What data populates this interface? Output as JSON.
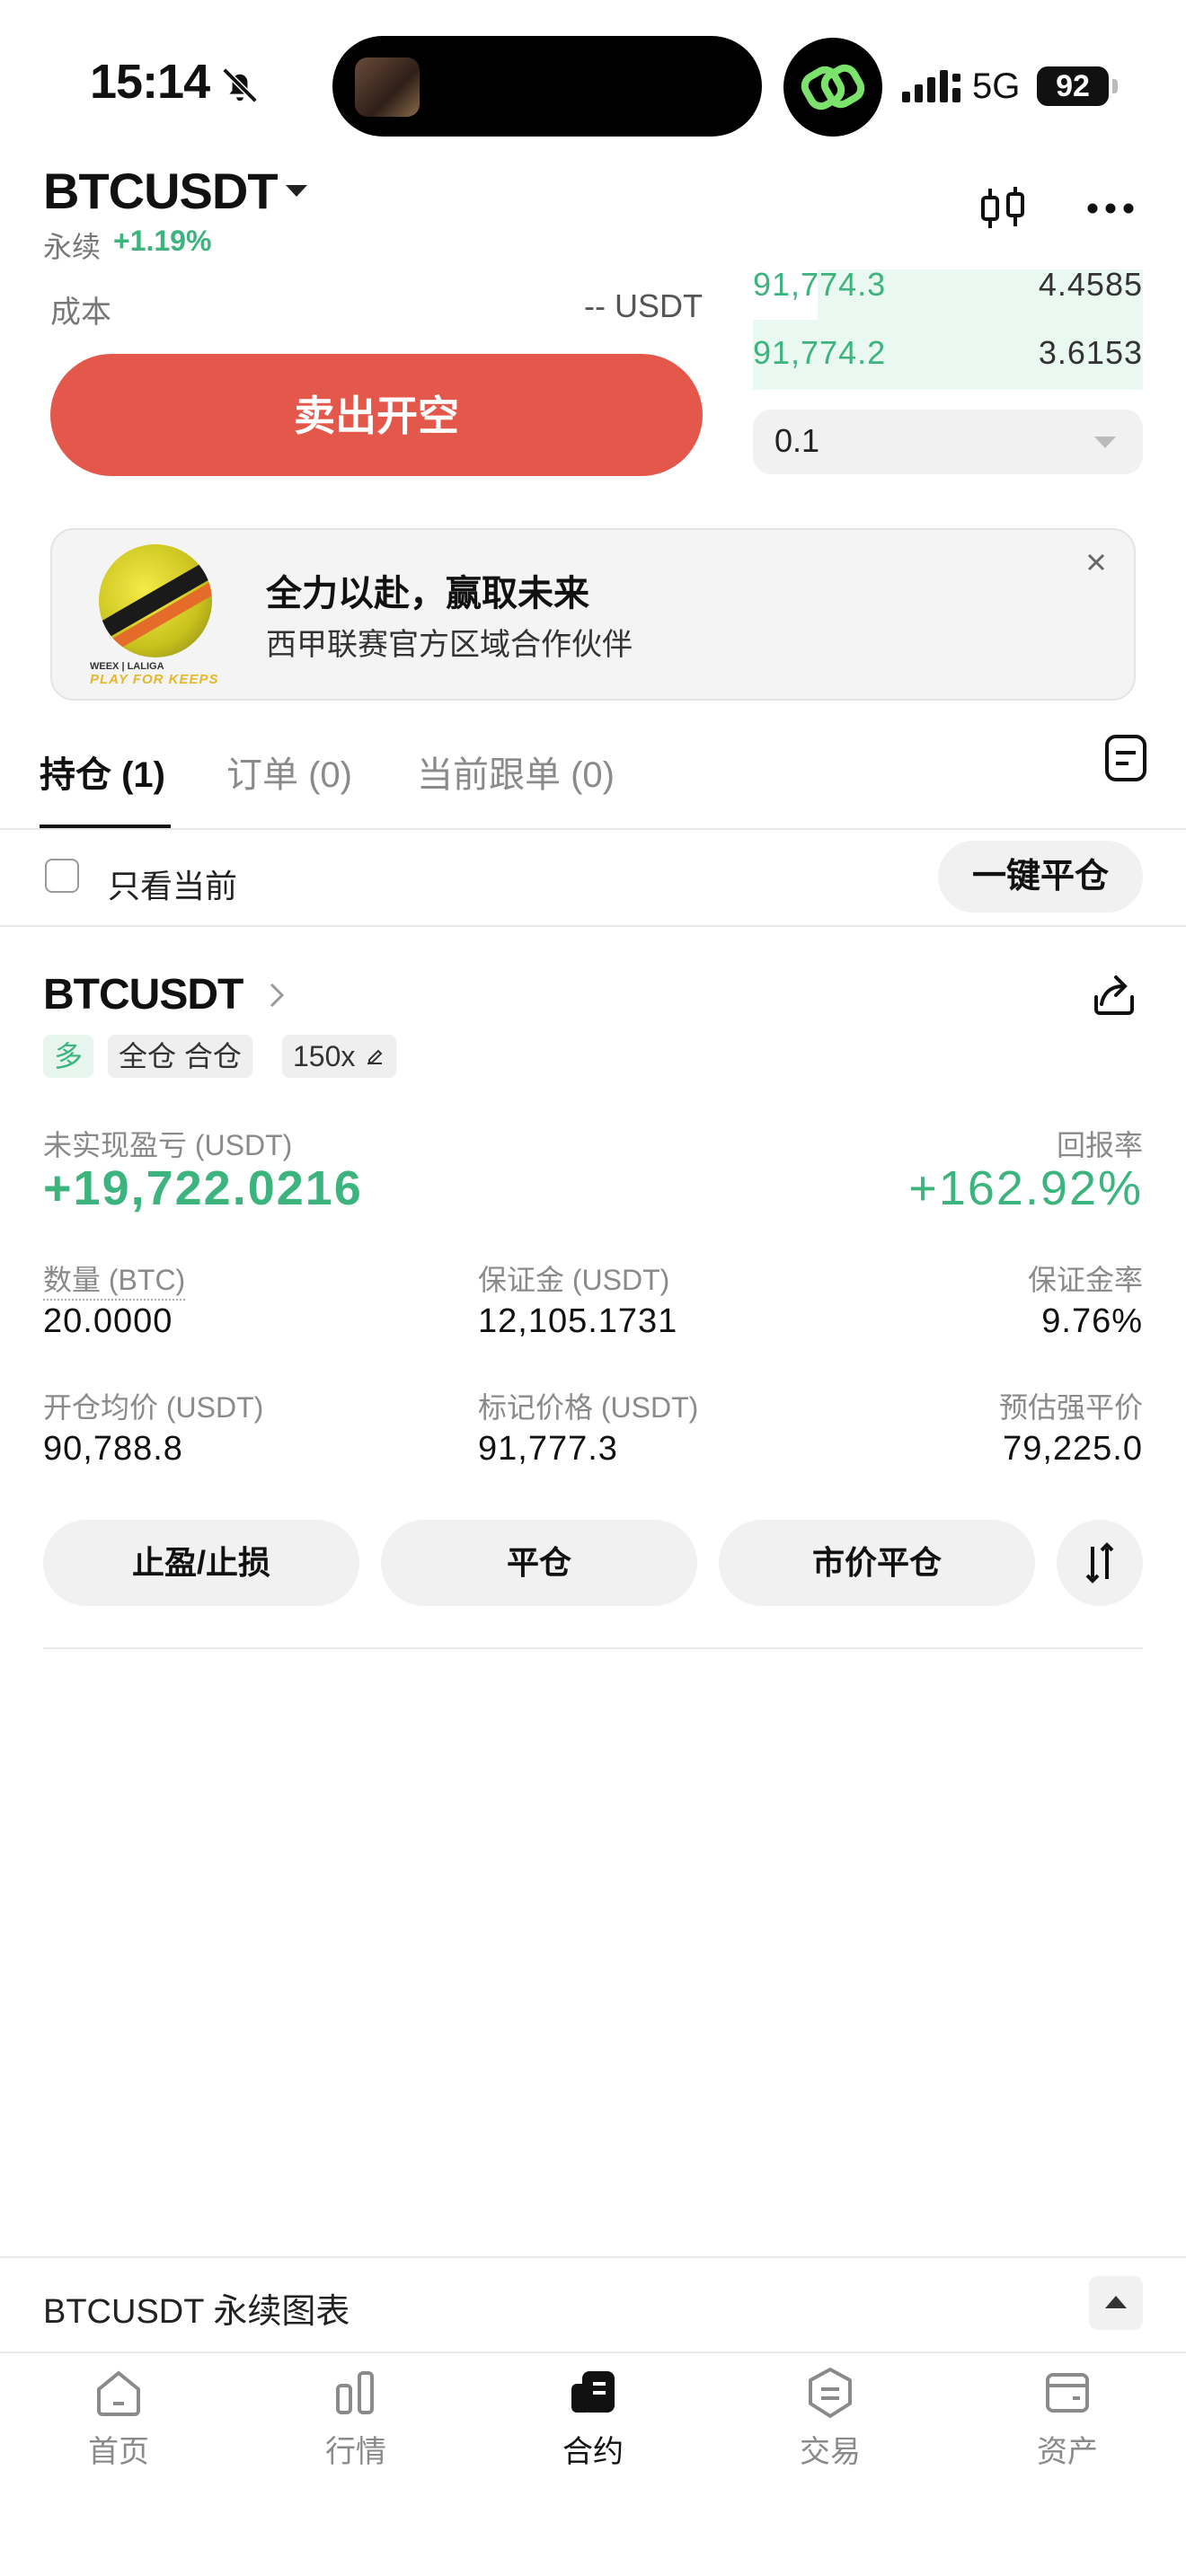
{
  "status_bar": {
    "time": "15:14",
    "network": "5G",
    "battery": "92"
  },
  "header": {
    "symbol": "BTCUSDT",
    "contract_type": "永续",
    "change": "+1.19%"
  },
  "order_form": {
    "cost_label": "成本",
    "cost_value": "-- USDT",
    "sell_button": "卖出开空",
    "quantity": "0.1"
  },
  "order_book": {
    "asks": [
      {
        "price": "91,774.3",
        "size": "4.4585"
      },
      {
        "price": "91,774.2",
        "size": "3.6153"
      }
    ]
  },
  "banner": {
    "title": "全力以赴，赢取未来",
    "subtitle": "西甲联赛官方区域合作伙伴",
    "logo_text_1": "WEEX | LALIGA",
    "logo_text_2": "PLAY FOR KEEPS"
  },
  "tabs": [
    {
      "label": "持仓 (1)"
    },
    {
      "label": "订单 (0)"
    },
    {
      "label": "当前跟单 (0)"
    }
  ],
  "filter": {
    "only_current": "只看当前",
    "close_all": "一键平仓"
  },
  "position": {
    "symbol": "BTCUSDT",
    "tags": {
      "side": "多",
      "margin_mode": "全仓 合仓",
      "leverage": "150x"
    },
    "unrealized_pnl_label": "未实现盈亏 (USDT)",
    "unrealized_pnl": "+19,722.0216",
    "roe_label": "回报率",
    "roe": "+162.92%",
    "qty_label": "数量 (BTC)",
    "qty": "20.0000",
    "margin_label": "保证金 (USDT)",
    "margin": "12,105.1731",
    "margin_ratio_label": "保证金率",
    "margin_ratio": "9.76%",
    "entry_label": "开仓均价 (USDT)",
    "entry": "90,788.8",
    "mark_label": "标记价格 (USDT)",
    "mark": "91,777.3",
    "liq_label": "预估强平价",
    "liq": "79,225.0",
    "buttons": {
      "tpsl": "止盈/止损",
      "close": "平仓",
      "market_close": "市价平仓"
    }
  },
  "chart_bar": {
    "label": "BTCUSDT 永续图表"
  },
  "nav": [
    {
      "label": "首页",
      "icon": "home-icon"
    },
    {
      "label": "行情",
      "icon": "market-icon"
    },
    {
      "label": "合约",
      "icon": "futures-icon"
    },
    {
      "label": "交易",
      "icon": "trade-icon"
    },
    {
      "label": "资产",
      "icon": "wallet-icon"
    }
  ],
  "colors": {
    "green": "#3db37e",
    "sell": "#e4584b"
  }
}
